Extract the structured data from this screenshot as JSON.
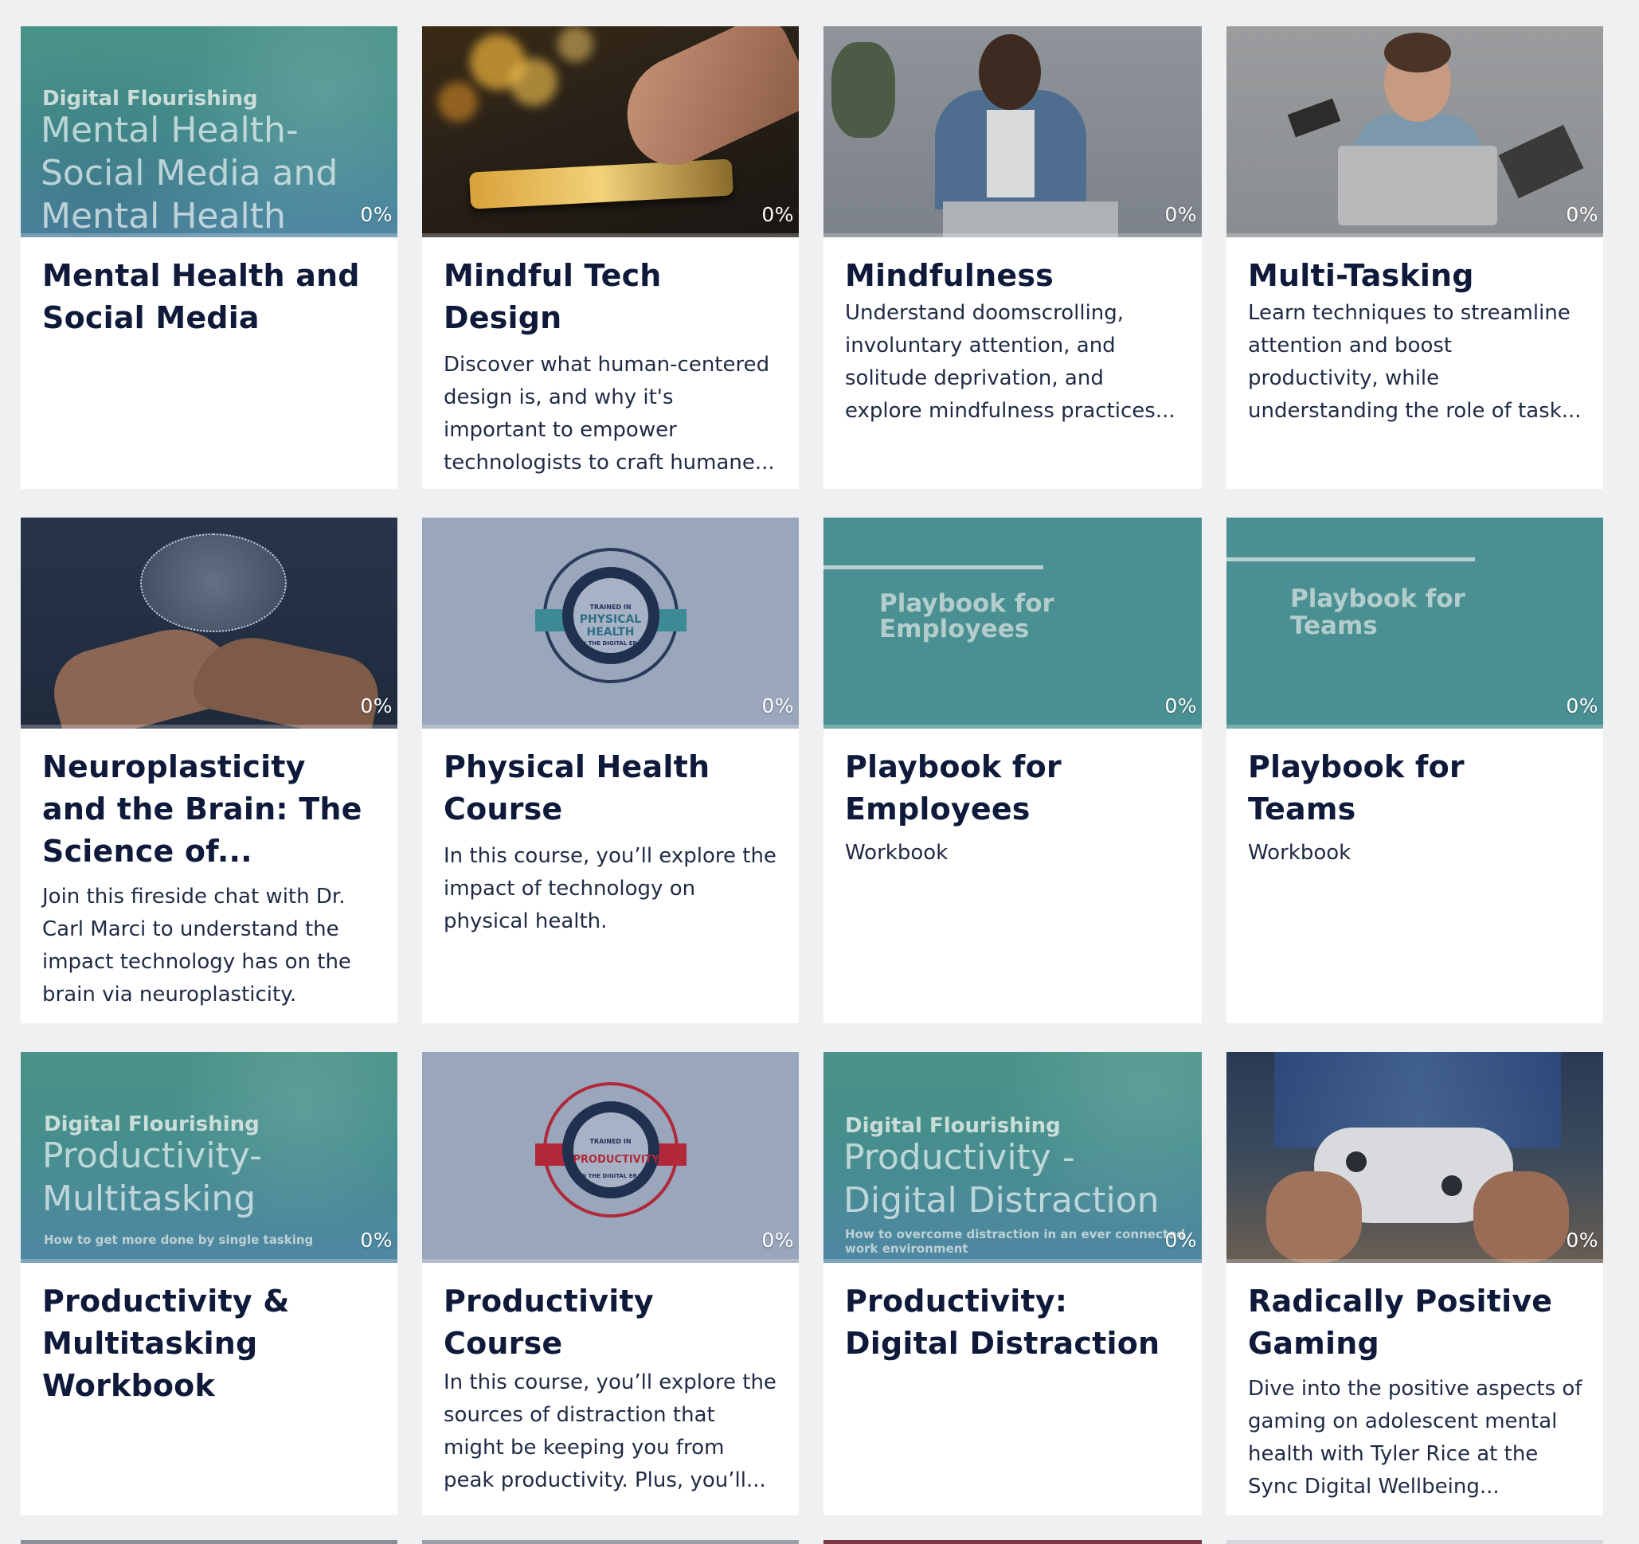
{
  "cards": [
    {
      "title": "Mental Health and Social Media",
      "description": "",
      "progress": "0%",
      "thumb": {
        "kicker": "Digital Flourishing",
        "lines": [
          "Mental Health-",
          "Social Media and",
          "Mental Health"
        ]
      }
    },
    {
      "title": "Mindful Tech Design",
      "description": "Discover what human-centered design is, and why it's important to empower technologists to craft humane...",
      "progress": "0%"
    },
    {
      "title": "Mindfulness",
      "description": "Understand doomscrolling, involuntary attention, and solitude deprivation, and explore mindfulness practices...",
      "progress": "0%"
    },
    {
      "title": "Multi-Tasking",
      "description": "Learn techniques to streamline attention and boost productivity, while understanding the role of task...",
      "progress": "0%"
    },
    {
      "title": "Neuroplasticity and the Brain: The Science of...",
      "description": "Join this fireside chat with Dr. Carl Marci to understand the impact technology has on the brain via neuroplasticity.",
      "progress": "0%"
    },
    {
      "title": "Physical Health Course",
      "description": "In this course, you’ll explore the impact of technology on physical health.",
      "progress": "0%",
      "thumb": {
        "top": "TRAINED IN",
        "main": [
          "PHYSICAL",
          "HEALTH"
        ],
        "bottom": "IN THE DIGITAL ERA"
      }
    },
    {
      "title": "Playbook for Employees",
      "description": "Workbook",
      "progress": "0%",
      "thumb": {
        "lines": [
          "Playbook for",
          "Employees"
        ]
      }
    },
    {
      "title": "Playbook for Teams",
      "description": "Workbook",
      "progress": "0%",
      "thumb": {
        "lines": [
          "Playbook for",
          "Teams"
        ]
      }
    },
    {
      "title": "Productivity & Multitasking Workbook",
      "description": "",
      "progress": "0%",
      "thumb": {
        "kicker": "Digital Flourishing",
        "lines": [
          "Productivity-",
          "Multitasking"
        ],
        "small": "How to get more done by single tasking"
      }
    },
    {
      "title": "Productivity Course",
      "description": "In this course, you’ll explore the sources of distraction that might be keeping you from peak productivity. Plus, you’ll...",
      "progress": "0%",
      "thumb": {
        "top": "TRAINED IN",
        "main": [
          "PRODUCTIVITY"
        ],
        "bottom": "IN THE DIGITAL ERA"
      }
    },
    {
      "title": "Productivity: Digital Distraction",
      "description": "",
      "progress": "0%",
      "thumb": {
        "kicker": "Digital Flourishing",
        "lines": [
          "Productivity -",
          "Digital Distraction"
        ],
        "small": [
          "How to overcome distraction in an ever connected",
          "work environment"
        ]
      }
    },
    {
      "title": "Radically Positive Gaming",
      "description": "Dive into the positive aspects of gaming on adolescent mental health with Tyler Rice at the Sync Digital Wellbeing...",
      "progress": "0%"
    }
  ],
  "colors": {
    "background": "#eff0f2",
    "title": "#0f1a3a",
    "teal": "#4a8f91",
    "slate": "#9aa6bb",
    "ribbon_teal": "#3d8a97",
    "ribbon_red": "#b0283a"
  },
  "icons": [
    "brain-image",
    "controller-image",
    "tablet-image",
    "laptop-image"
  ]
}
